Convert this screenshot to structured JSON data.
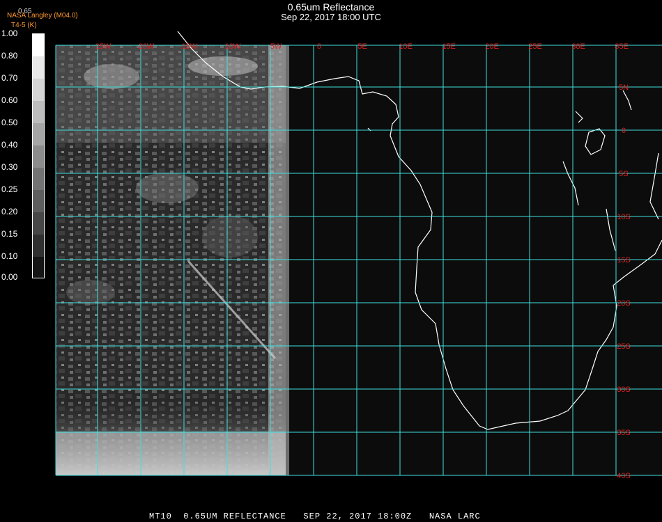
{
  "title": {
    "line1": "0.65um Reflectance",
    "line2": "Sep 22, 2017 18:00 UTC"
  },
  "credits": {
    "top": "0.65",
    "org": "NASA Langley (M04.0)",
    "sub": "T4-5 (K)"
  },
  "legend": {
    "labels": [
      "1.00",
      "0.80",
      "0.70",
      "0.60",
      "0.50",
      "0.40",
      "0.30",
      "0.25",
      "0.20",
      "0.15",
      "0.10",
      "0.00"
    ]
  },
  "map": {
    "grid_color": "#40e0e0",
    "coast_color": "#ffffff",
    "label_color": "#e02020",
    "lon_labels": [
      "25W",
      "20W",
      "15W",
      "10W",
      "5W",
      "0",
      "5E",
      "10E",
      "15E",
      "20E",
      "25E",
      "30E",
      "35E"
    ],
    "lat_labels": [
      "5N",
      "0",
      "5S",
      "10S",
      "15S",
      "20S",
      "25S",
      "30S",
      "35S",
      "40S"
    ]
  },
  "footer": {
    "text": "MT10  0.65UM REFLECTANCE   SEP 22, 2017 18:00Z   NASA LARC"
  }
}
